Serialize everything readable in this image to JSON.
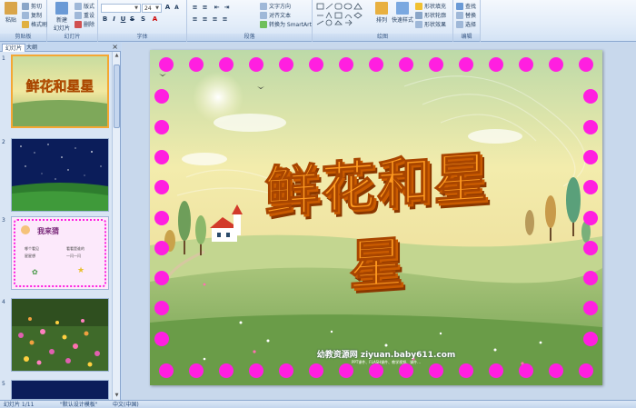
{
  "ribbon": {
    "groups": {
      "clipboard": {
        "label": "剪贴板",
        "paste": "粘贴",
        "cut": "剪切",
        "copy": "复制",
        "format_painter": "格式刷"
      },
      "slides": {
        "label": "幻灯片",
        "new_slide": "新建\n幻灯片",
        "layout": "版式",
        "reset": "重设",
        "delete": "删除"
      },
      "font": {
        "label": "字体",
        "font_name": "",
        "font_size": "24"
      },
      "paragraph": {
        "label": "段落",
        "text_direction": "文字方向",
        "align_text": "对齐文本",
        "smartart": "转换为 SmartArt"
      },
      "drawing": {
        "label": "绘图",
        "arrange": "排列",
        "quick_styles": "快速样式",
        "shape_fill": "形状填充",
        "shape_outline": "形状轮廓",
        "shape_effects": "形状效果"
      },
      "editing": {
        "label": "编辑",
        "find": "查找",
        "replace": "替换",
        "select": "选择"
      }
    }
  },
  "left_pane": {
    "tabs": [
      "幻灯片",
      "大纲"
    ],
    "close": "×",
    "slide_numbers": [
      "1",
      "2",
      "3",
      "4",
      "5"
    ],
    "thumb3": {
      "title": "我来猜",
      "line1": "哪个看见",
      "line2": "星星想",
      "line3": "看看是谁的",
      "line4": "一闪一闪"
    }
  },
  "slide": {
    "title": "鲜花和星星",
    "watermark": "幼教资源网 ziyuan.baby611.com",
    "watermark_sub": "PPT课件、FLASH课件、教学视频、课件..."
  },
  "status_bar": {
    "slide_count": "幻灯片 1/11",
    "theme": "\"默认设计模板\"",
    "language": "中文(中国)"
  },
  "colors": {
    "dot": "#ff1fe0",
    "title": "#ff9a1f",
    "selected_border": "#f5a733"
  }
}
